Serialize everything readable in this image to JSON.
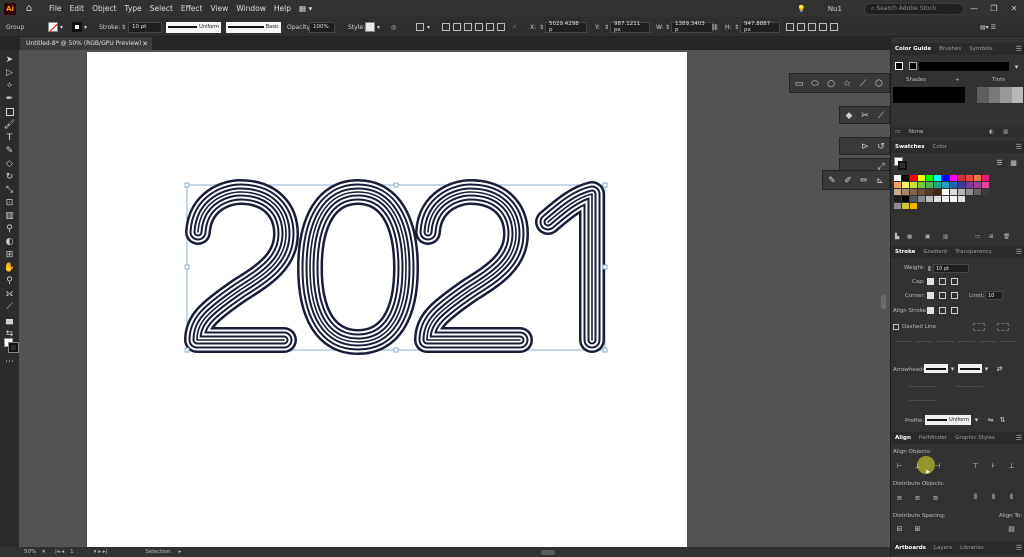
{
  "menubar": {
    "app_logo": "Ai",
    "items": [
      "File",
      "Edit",
      "Object",
      "Type",
      "Select",
      "Effect",
      "View",
      "Window",
      "Help"
    ],
    "workspace": "Nu1",
    "search_placeholder": "Search Adobe Stock"
  },
  "control": {
    "selection_label": "Group",
    "stroke_label": "Stroke:",
    "stroke_weight": "10 pt",
    "profile": "Uniform",
    "brush": "Basic",
    "opacity_label": "Opacity:",
    "opacity": "100%",
    "style_label": "Style:",
    "x_label": "X:",
    "x": "5029.4298 p",
    "y_label": "Y:",
    "y": "987.1211 px",
    "w_label": "W:",
    "w": "1389.3403 p",
    "h_label": "H:",
    "h": "947.8887 px"
  },
  "document": {
    "tab_title": "Untitled-8* @ 50% (RGB/GPU Preview)",
    "artwork_text": "2021"
  },
  "status": {
    "zoom": "50%",
    "artboard": "1",
    "tool": "Selection"
  },
  "panels": {
    "color_guide_tabs": [
      "Color Guide",
      "Brushes",
      "Symbols"
    ],
    "shades": "Shades",
    "tints": "Tints",
    "none_label": "None",
    "swatch_tabs": [
      "Swatches",
      "Color"
    ],
    "stroke_tabs": [
      "Stroke",
      "Gradient",
      "Transparency"
    ],
    "weight_label": "Weight:",
    "weight": "10 pt",
    "cap_label": "Cap:",
    "corner_label": "Corner:",
    "limit_label": "Limit:",
    "limit": "10",
    "align_stroke_label": "Align Stroke:",
    "dashed_label": "Dashed Line",
    "arrowheads_label": "Arrowheads:",
    "profile_label": "Profile:",
    "profile": "Uniform",
    "align_tabs": [
      "Align",
      "Pathfinder",
      "Graphic Styles"
    ],
    "align_objects": "Align Objects:",
    "distribute_objects": "Distribute Objects:",
    "distribute_spacing": "Distribute Spacing:",
    "align_to": "Align To:",
    "bottom_tabs": [
      "Artboards",
      "Layers",
      "Libraries"
    ]
  },
  "colors": {
    "artwork_stroke": "#1a1d3a",
    "selection": "#6ea0c8",
    "swatches_row1": [
      "#ffffff",
      "#000000",
      "#ff0000",
      "#ffff00",
      "#00ff00",
      "#00ffff",
      "#0000ff",
      "#ff00ff",
      "#c8323c",
      "#e6463c",
      "#f07846",
      "#e61e78"
    ],
    "swatches_row2": [
      "#f0a064",
      "#fff064",
      "#c8e632",
      "#78c83c",
      "#50b450",
      "#1eaa78",
      "#1ea0c8",
      "#1e64b4",
      "#3c3c96",
      "#783c96",
      "#a03c96",
      "#e6469b"
    ],
    "swatches_row3": [
      "#c8aa8c",
      "#a0826e",
      "#826450",
      "#6e5037",
      "#503c28",
      "#3c2814",
      "#ffffff",
      "#dcdcdc",
      "#b4b4b4",
      "#8c8c8c",
      "#646464",
      "#3c3c3c"
    ],
    "swatches_row4": [
      "#1e1e1e",
      "#000000",
      "#555555",
      "#888888",
      "#bbbbbb",
      "#dddddd",
      "#eeeeee",
      "#f5f5f5",
      "#e0e0e0"
    ],
    "swatches_row5": [
      "#8c8c8c",
      "#c8c832",
      "#f0b400"
    ]
  }
}
